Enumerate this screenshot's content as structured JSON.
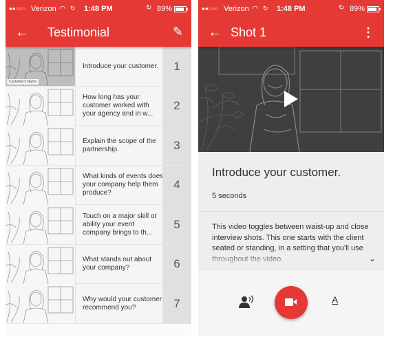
{
  "status_bar": {
    "carrier": "Verizon",
    "time": "1:48 PM",
    "battery": "89%"
  },
  "left_screen": {
    "title": "Testimonial",
    "thumbnail_caption": "Customer's Name",
    "shots": [
      {
        "number": "1",
        "prompt": "Introduce your customer."
      },
      {
        "number": "2",
        "prompt": "How long has your customer worked with your agency and in w..."
      },
      {
        "number": "3",
        "prompt": "Explain the scope of the partnership."
      },
      {
        "number": "4",
        "prompt": "What kinds of events does your company help them produce?"
      },
      {
        "number": "5",
        "prompt": "Touch on a major skill or ability your event company brings to th..."
      },
      {
        "number": "6",
        "prompt": "What stands out about your company?"
      },
      {
        "number": "7",
        "prompt": "Why would your customer recommend you?"
      }
    ]
  },
  "right_screen": {
    "title": "Shot 1",
    "shot_title": "Introduce your customer.",
    "duration": "5 seconds",
    "description": "This video toggles between waist-up and close interview shots. This one starts with the client seated or standing, in a setting that you'll use throughout the video."
  },
  "colors": {
    "brand_red": "#e53935",
    "list_number_bg": "#e0e0e0"
  },
  "icons": {
    "back": "arrow-left",
    "edit": "pencil",
    "more": "vertical-ellipsis",
    "play": "play-triangle",
    "voiceover": "person-speaking",
    "record": "videocam",
    "text": "underlined-A",
    "expand": "chevron-down"
  }
}
